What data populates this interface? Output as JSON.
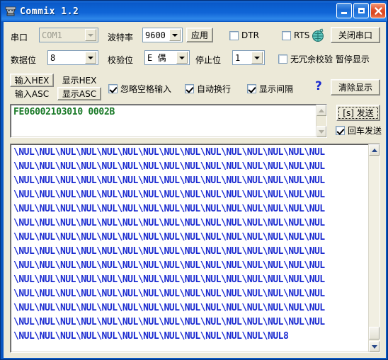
{
  "window": {
    "title": "Commix 1.2",
    "icon": "serial-terminal-icon",
    "minimize_label": "Minimize",
    "maximize_label": "Maximize",
    "close_label": "Close",
    "titlebar_color": "#0a59c8",
    "client_color": "#ece9d8"
  },
  "settings": {
    "port_label": "串口",
    "port_value": "COM1",
    "baud_label": "波特率",
    "baud_value": "9600",
    "apply_label": "应用",
    "dtr_label": "DTR",
    "dtr_checked": false,
    "rts_label": "RTS",
    "rts_checked": false,
    "globe_icon": "network-globe-icon",
    "close_port_label": "关闭串口",
    "databits_label": "数据位",
    "databits_value": "8",
    "parity_label": "校验位",
    "parity_value": "E 偶",
    "stopbits_label": "停止位",
    "stopbits_value": "1",
    "no_redundancy_label": "无冗余校验 暂停显示",
    "no_redundancy_checked": false
  },
  "format_bar": {
    "input_hex_label": "输入HEX",
    "input_asc_label": "输入ASC",
    "input_mode_selected": "HEX",
    "display_hex_label": "显示HEX",
    "display_asc_label": "显示ASC",
    "display_mode_selected": "ASC",
    "ignore_space_label": "忽略空格输入",
    "ignore_space_checked": true,
    "auto_wrap_label": "自动换行",
    "auto_wrap_checked": true,
    "show_interval_label": "显示间隔",
    "show_interval_checked": true,
    "help_label": "?",
    "clear_display_label": "清除显示"
  },
  "send_area": {
    "text": "FE06002103010 0002B",
    "text_color": "#1a7a28",
    "send_button_label": "[s] 发送",
    "enter_sends_label": "回车发送",
    "enter_sends_checked": true
  },
  "receive_area": {
    "text_color": "#1a2ad0",
    "lines": [
      "\\NUL\\NUL\\NUL\\NUL\\NUL\\NUL\\NUL\\NUL\\NUL\\NUL\\NUL\\NUL\\NUL\\NUL\\NUL",
      "\\NUL\\NUL\\NUL\\NUL\\NUL\\NUL\\NUL\\NUL\\NUL\\NUL\\NUL\\NUL\\NUL\\NUL\\NUL",
      "\\NUL\\NUL\\NUL\\NUL\\NUL\\NUL\\NUL\\NUL\\NUL\\NUL\\NUL\\NUL\\NUL\\NUL\\NUL",
      "\\NUL\\NUL\\NUL\\NUL\\NUL\\NUL\\NUL\\NUL\\NUL\\NUL\\NUL\\NUL\\NUL\\NUL\\NUL",
      "\\NUL\\NUL\\NUL\\NUL\\NUL\\NUL\\NUL\\NUL\\NUL\\NUL\\NUL\\NUL\\NUL\\NUL\\NUL",
      "\\NUL\\NUL\\NUL\\NUL\\NUL\\NUL\\NUL\\NUL\\NUL\\NUL\\NUL\\NUL\\NUL\\NUL\\NUL",
      "\\NUL\\NUL\\NUL\\NUL\\NUL\\NUL\\NUL\\NUL\\NUL\\NUL\\NUL\\NUL\\NUL\\NUL\\NUL",
      "\\NUL\\NUL\\NUL\\NUL\\NUL\\NUL\\NUL\\NUL\\NUL\\NUL\\NUL\\NUL\\NUL\\NUL\\NUL",
      "\\NUL\\NUL\\NUL\\NUL\\NUL\\NUL\\NUL\\NUL\\NUL\\NUL\\NUL\\NUL\\NUL\\NUL\\NUL",
      "\\NUL\\NUL\\NUL\\NUL\\NUL\\NUL\\NUL\\NUL\\NUL\\NUL\\NUL\\NUL\\NUL\\NUL\\NUL",
      "\\NUL\\NUL\\NUL\\NUL\\NUL\\NUL\\NUL\\NUL\\NUL\\NUL\\NUL\\NUL\\NUL\\NUL\\NUL",
      "\\NUL\\NUL\\NUL\\NUL\\NUL\\NUL\\NUL\\NUL\\NUL\\NUL\\NUL\\NUL\\NUL\\NUL\\NUL",
      "\\NUL\\NUL\\NUL\\NUL\\NUL\\NUL\\NUL\\NUL\\NUL\\NUL\\NUL\\NUL\\NUL\\NUL\\NUL",
      "\\NUL\\NUL\\NUL\\NUL\\NUL\\NUL\\NUL\\NUL\\NUL\\NUL\\NUL\\NUL\\NUL8"
    ]
  }
}
